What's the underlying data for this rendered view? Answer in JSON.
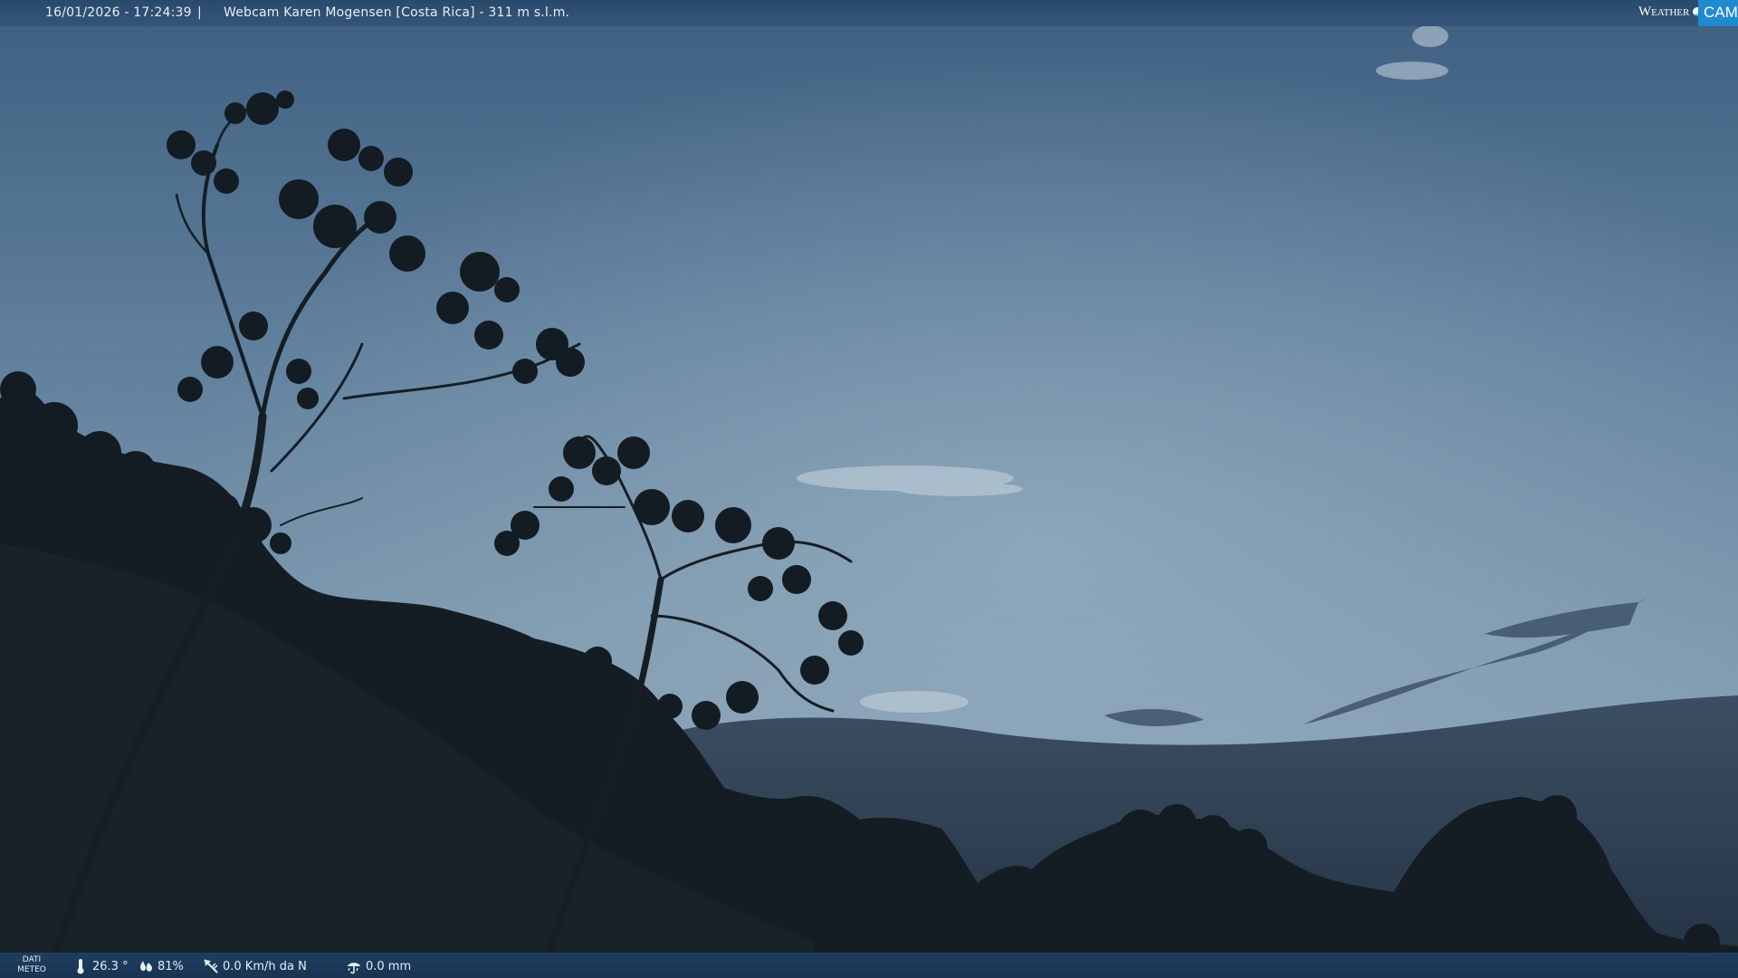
{
  "header": {
    "timestamp": "16/01/2026 - 17:24:39",
    "separator": "|",
    "camera_title": "Webcam Karen Mogensen [Costa Rica] - 311 m s.l.m."
  },
  "logo": {
    "word": "Weather",
    "suffix": "CAM"
  },
  "weather": {
    "label_line1": "DATI",
    "label_line2": "METEO",
    "temperature": "26.3 °",
    "humidity": "81%",
    "wind": "0.0 Km/h da N",
    "rain": "0.0 mm"
  },
  "icons": {
    "temperature": "thermometer-icon",
    "humidity": "humidity-drops-icon",
    "wind": "wind-direction-icon",
    "rain": "rain-gauge-icon"
  },
  "colors": {
    "bar": "#2a4a6c",
    "logo_accent": "#1f8ad0",
    "sky": "#6b879f"
  }
}
